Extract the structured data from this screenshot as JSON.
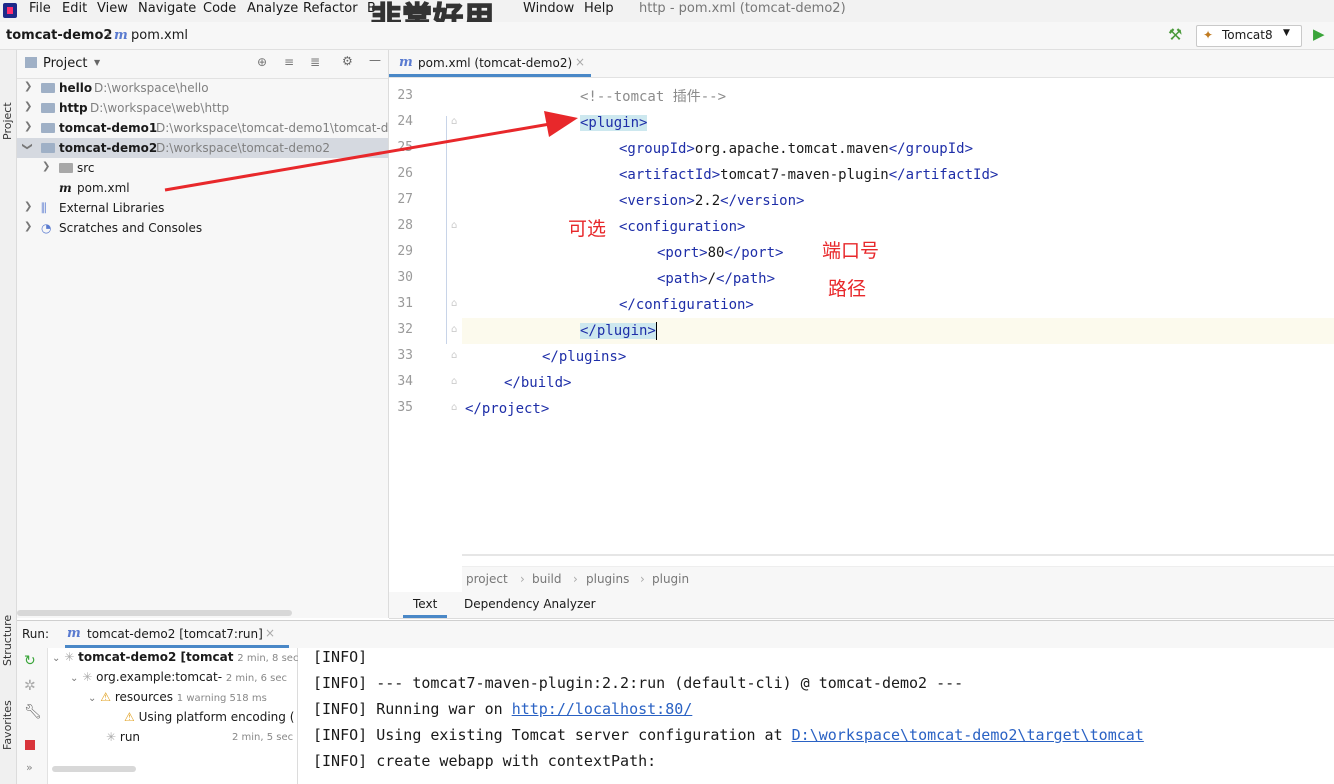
{
  "menubar": {
    "items": [
      "File",
      "Edit",
      "View",
      "Navigate",
      "Code",
      "Analyze",
      "Refactor",
      "B",
      "Window",
      "Help"
    ],
    "window_title": "http - pom.xml (tomcat-demo2)",
    "overlay_note": "非常好用"
  },
  "navbar": {
    "project": "tomcat-demo2",
    "file": "pom.xml",
    "run_config": "Tomcat8"
  },
  "left_strip": {
    "project": "Project",
    "structure": "Structure",
    "favorites": "Favorites"
  },
  "project_panel": {
    "title": "Project",
    "items": [
      {
        "name": "hello",
        "path": "D:\\workspace\\hello"
      },
      {
        "name": "http",
        "path": "D:\\workspace\\web\\http"
      },
      {
        "name": "tomcat-demo1",
        "path": "D:\\workspace\\tomcat-demo1\\tomcat-d"
      },
      {
        "name": "tomcat-demo2",
        "path": "D:\\workspace\\tomcat-demo2"
      },
      {
        "name": "src",
        "path": ""
      },
      {
        "name": "pom.xml",
        "path": ""
      },
      {
        "name": "External Libraries",
        "path": ""
      },
      {
        "name": "Scratches and Consoles",
        "path": ""
      }
    ]
  },
  "editor": {
    "tab_label": "pom.xml (tomcat-demo2)",
    "line_numbers": [
      "23",
      "24",
      "25",
      "26",
      "27",
      "28",
      "29",
      "30",
      "31",
      "32",
      "33",
      "34",
      "35"
    ],
    "lines": {
      "l23": "<!--tomcat 插件-->",
      "l24": "<plugin>",
      "l26a": "<artifactId>",
      "l26b": "tomcat7-maven-plugin",
      "l26c": "</artifactId>",
      "l25a": "<groupId>",
      "l25b": "org.apache.tomcat.maven",
      "l25c": "</groupId>",
      "l27a": "<version>",
      "l27b": "2.2",
      "l27c": "</version>",
      "l28": "<configuration>",
      "l29a": "<port>",
      "l29b": "80",
      "l29c": "</port>",
      "l30a": "<path>",
      "l30b": "/",
      "l30c": "</path>",
      "l31": "</configuration>",
      "l32": "</plugin>",
      "l33": "</plugins>",
      "l34": "</build>",
      "l35": "</project>"
    },
    "annotations": {
      "optional": "可选",
      "port": "端口号",
      "path": "路径"
    },
    "breadcrumb": [
      "project",
      "build",
      "plugins",
      "plugin"
    ],
    "bottom_tabs": [
      "Text",
      "Dependency Analyzer"
    ]
  },
  "run": {
    "label": "Run:",
    "tab": "tomcat-demo2 [tomcat7:run]",
    "tree": [
      {
        "label": "tomcat-demo2 [tomcat",
        "time": "2 min, 8 sec"
      },
      {
        "label": "org.example:tomcat-",
        "time": "2 min, 6 sec"
      },
      {
        "label": "resources",
        "time": "1 warning   518 ms"
      },
      {
        "label": "Using platform encoding (",
        "time": ""
      },
      {
        "label": "run",
        "time": "2 min, 5 sec"
      }
    ],
    "console": {
      "l1": "[INFO]",
      "l2": "[INFO] --- tomcat7-maven-plugin:2.2:run (default-cli) @ tomcat-demo2 ---",
      "l3a": "[INFO] Running war on ",
      "l3b": "http://localhost:80/",
      "l4a": "[INFO] Using existing Tomcat server configuration at ",
      "l4b": "D:\\workspace\\tomcat-demo2\\target\\tomcat",
      "l5": "[INFO] create webapp with contextPath:"
    }
  }
}
